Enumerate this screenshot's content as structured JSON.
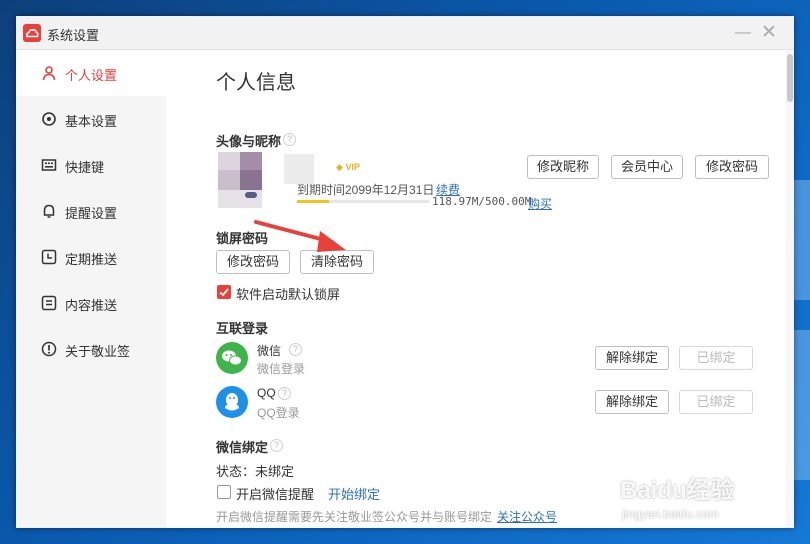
{
  "window": {
    "title": "系统设置",
    "min_glyph": "—",
    "close_glyph": "✕"
  },
  "sidebar": {
    "items": [
      {
        "label": "个人设置",
        "icon": "user-icon",
        "active": true
      },
      {
        "label": "基本设置",
        "icon": "gear-icon",
        "active": false
      },
      {
        "label": "快捷键",
        "icon": "keyboard-icon",
        "active": false
      },
      {
        "label": "提醒设置",
        "icon": "bell-icon",
        "active": false
      },
      {
        "label": "定期推送",
        "icon": "clock-icon",
        "active": false
      },
      {
        "label": "内容推送",
        "icon": "document-icon",
        "active": false
      },
      {
        "label": "关于敬业签",
        "icon": "info-icon",
        "active": false
      }
    ]
  },
  "main": {
    "title": "个人信息",
    "profile": {
      "section_title": "头像与昵称",
      "vip_badge": "VIP",
      "expire_text": "到期时间2099年12月31日",
      "renew_link": "续费",
      "storage_text": "118.97M/500.00M",
      "storage_used_fraction": 0.24,
      "buy_link": "购买",
      "buttons": [
        "修改昵称",
        "会员中心",
        "修改密码"
      ]
    },
    "lock": {
      "section_title": "锁屏密码",
      "change_btn": "修改密码",
      "clear_btn": "清除密码",
      "default_lock_label": "软件启动默认锁屏",
      "default_lock_checked": true
    },
    "social": {
      "section_title": "互联登录",
      "accounts": [
        {
          "name": "微信",
          "sub": "微信登录",
          "unbind": "解除绑定",
          "status": "已绑定",
          "icon": "wechat-icon",
          "color": "#3fb44a"
        },
        {
          "name": "QQ",
          "sub": "QQ登录",
          "unbind": "解除绑定",
          "status": "已绑定",
          "icon": "qq-icon",
          "color": "#1e90e8"
        }
      ]
    },
    "wechat_bind": {
      "section_title": "微信绑定",
      "status": "状态：未绑定",
      "enable_label": "开启微信提醒",
      "enable_checked": false,
      "start_link": "开始绑定",
      "hint": "开启微信提醒需要先关注敬业签公众号并与账号绑定",
      "follow_link": "关注公众号"
    }
  },
  "watermark": {
    "logo": "Baidu经验",
    "url": "jingyan.baidu.com"
  },
  "colors": {
    "accent": "#e8413b",
    "link": "#2a6fc2",
    "annotation_arrow": "#e8413b"
  }
}
